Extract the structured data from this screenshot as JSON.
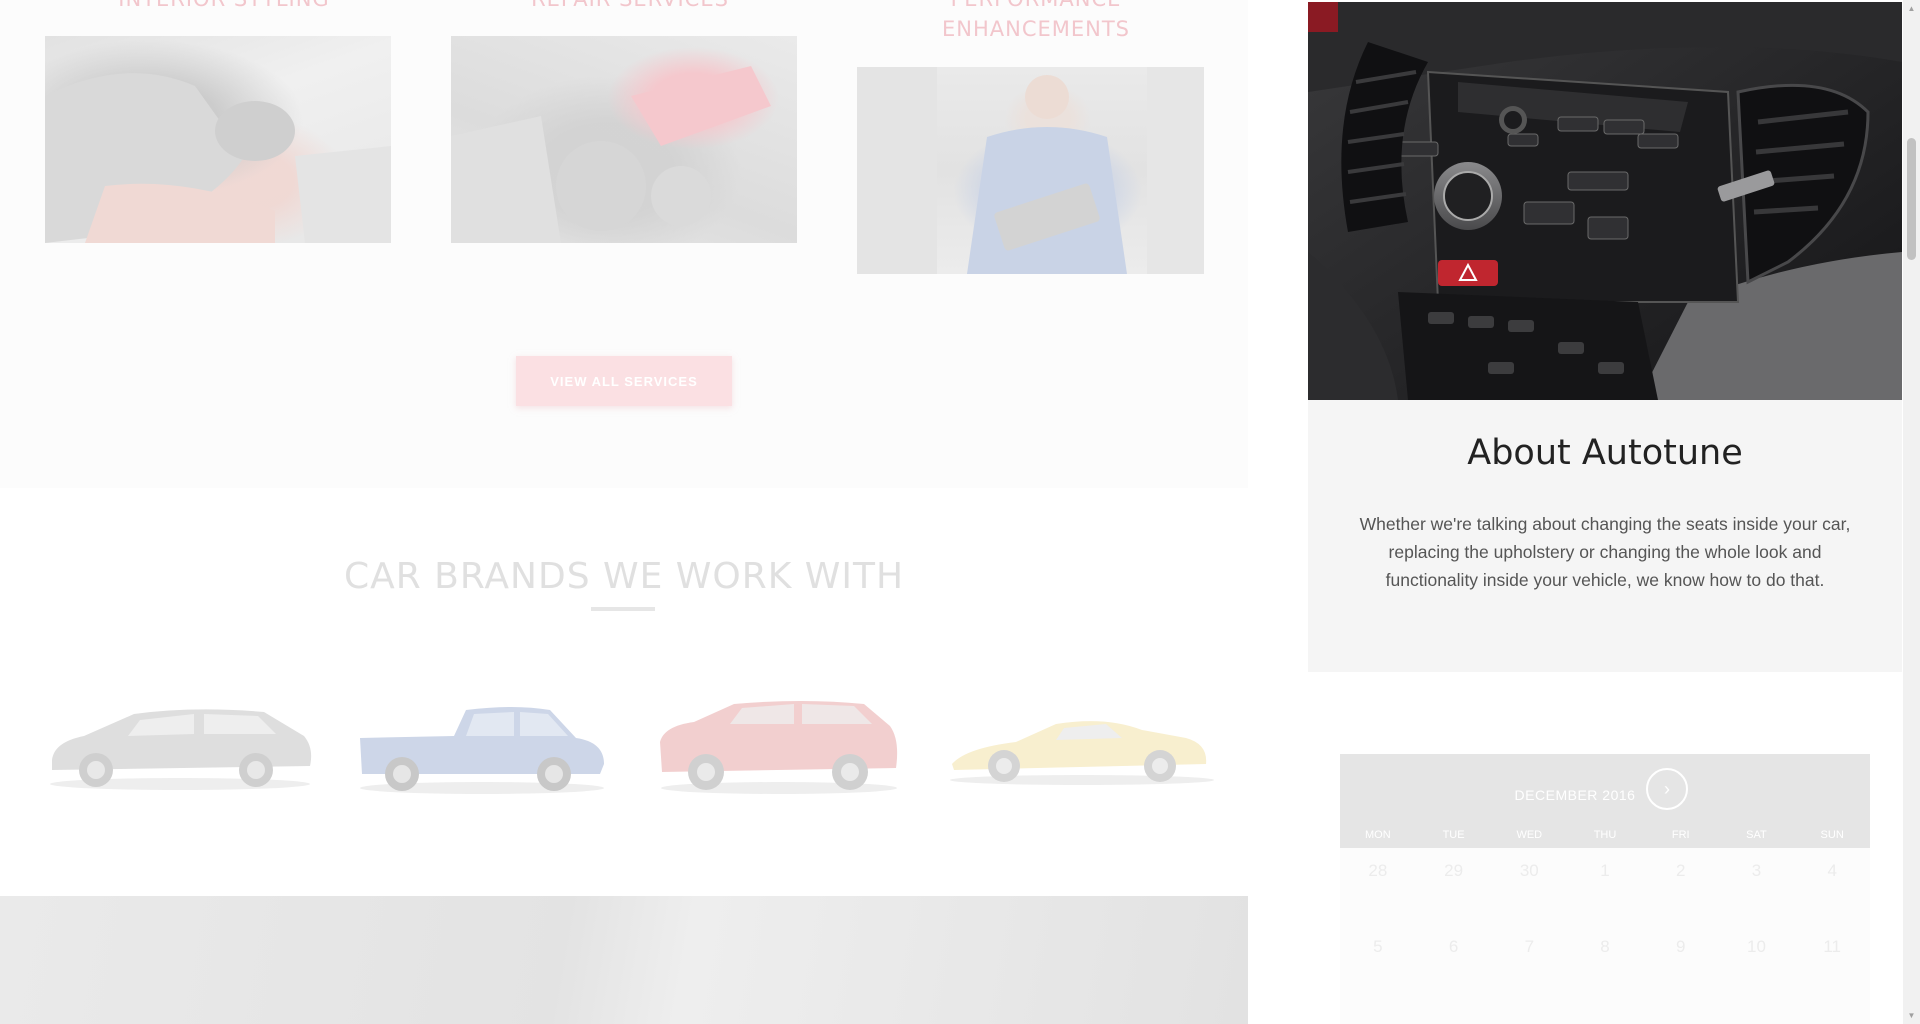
{
  "services": [
    {
      "title": "Interior Styling",
      "icon": "interior-photo"
    },
    {
      "title": "Repair Services",
      "icon": "engine-repair-photo"
    },
    {
      "title": "Performance Enhancements",
      "icon": "mechanic-photo"
    }
  ],
  "view_all_label": "View all services",
  "brands": {
    "title": "Car brands we work with",
    "cars": [
      "silver-wagon",
      "blue-pickup",
      "red-suv",
      "yellow-supercar"
    ]
  },
  "side_panel": {
    "about_title": "About Autotune",
    "about_text": "Whether we're talking about changing the seats inside your car, replacing the upholstery or changing the whole look and functionality inside your vehicle, we know how to do that.",
    "calendar": {
      "month": "DECEMBER 2016",
      "next_icon": "›",
      "weekdays": [
        "MON",
        "TUE",
        "WED",
        "THU",
        "FRI",
        "SAT",
        "SUN"
      ],
      "weeks": [
        [
          "28",
          "29",
          "30",
          "1",
          "2",
          "3",
          "4"
        ],
        [
          "5",
          "6",
          "7",
          "8",
          "9",
          "10",
          "11"
        ]
      ]
    }
  },
  "colors": {
    "accent": "#e4263e",
    "faded_accent": "#fbe0e3",
    "about_bg": "#f5f5f5"
  }
}
